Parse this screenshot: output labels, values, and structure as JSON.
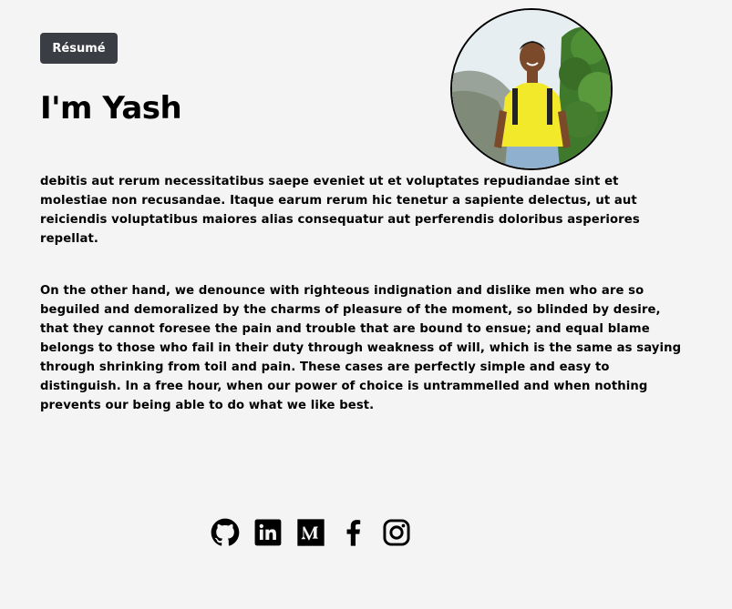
{
  "header": {
    "resume_label": "Résumé",
    "title": "I'm Yash"
  },
  "profile": {
    "avatar_icon": "profile-photo"
  },
  "content": {
    "paragraph_1": "debitis aut rerum necessitatibus saepe eveniet ut et voluptates repudiandae sint et molestiae non recusandae. Itaque earum rerum hic tenetur a sapiente delectus, ut aut reiciendis voluptatibus maiores alias consequatur aut perferendis doloribus asperiores repellat.",
    "paragraph_2": "On the other hand, we denounce with righteous indignation and dislike men who are so beguiled and demoralized by the charms of pleasure of the moment, so blinded by desire, that they cannot foresee the pain and trouble that are bound to ensue; and equal blame belongs to those who fail in their duty through weakness of will, which is the same as saying through shrinking from toil and pain. These cases are perfectly simple and easy to distinguish. In a free hour, when our power of choice is untrammelled and when nothing prevents our being able to do what we like best."
  },
  "socials": [
    {
      "icon": "github-icon"
    },
    {
      "icon": "linkedin-icon"
    },
    {
      "icon": "medium-icon"
    },
    {
      "icon": "facebook-icon"
    },
    {
      "icon": "instagram-icon"
    }
  ],
  "colors": {
    "background": "#f4f4f4",
    "button_bg": "#3a3d44",
    "button_text": "#ffffff",
    "text": "#000000",
    "shirt": "#f3e92b"
  }
}
